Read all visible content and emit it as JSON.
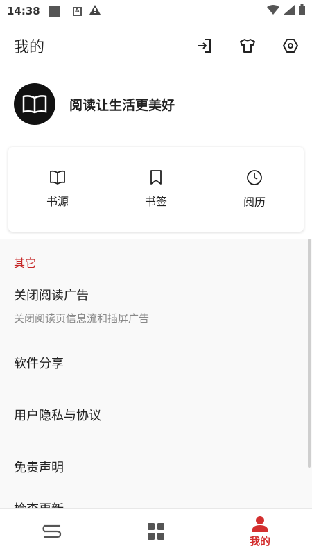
{
  "status_bar": {
    "time": "14:38",
    "notification_icons": [
      "app-icon",
      "a-icon",
      "warning-icon"
    ],
    "system_icons": [
      "wifi-icon",
      "signal-icon",
      "battery-icon"
    ]
  },
  "app_bar": {
    "title": "我的",
    "actions": [
      "import-icon",
      "theme-shirt-icon",
      "settings-icon"
    ]
  },
  "profile": {
    "avatar_icon": "book-icon",
    "slogan": "阅读让生活更美好"
  },
  "quick_actions": [
    {
      "label": "书源",
      "icon": "book-open-icon"
    },
    {
      "label": "书签",
      "icon": "bookmark-icon"
    },
    {
      "label": "阅历",
      "icon": "clock-icon"
    }
  ],
  "other_section": {
    "header": "其它",
    "items": [
      {
        "title": "关闭阅读广告",
        "subtitle": "关闭阅读页信息流和插屏广告"
      },
      {
        "title": "软件分享"
      },
      {
        "title": "用户隐私与协议"
      },
      {
        "title": "免责声明"
      },
      {
        "title": "检查更新"
      }
    ]
  },
  "bottom_nav": {
    "items": [
      {
        "icon": "bookshelf-icon",
        "label": ""
      },
      {
        "icon": "discover-grid-icon",
        "label": ""
      },
      {
        "icon": "profile-icon",
        "label": "我的",
        "active": true
      }
    ]
  },
  "colors": {
    "accent": "#d32f2f",
    "section_header": "#c62828",
    "background": "#f6f6f6"
  }
}
